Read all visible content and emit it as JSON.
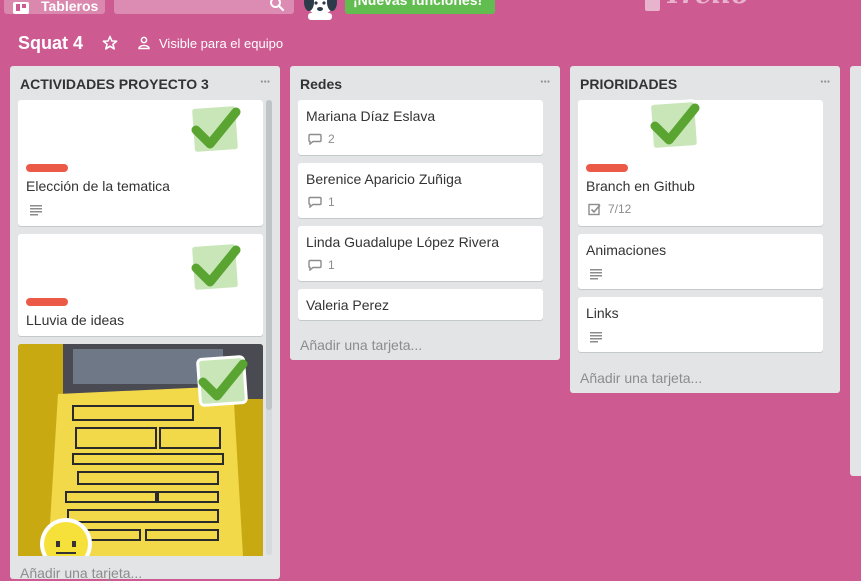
{
  "header": {
    "boards_label": "Tableros",
    "search_value": "",
    "new_features_label": "¡Nuevas funciones!",
    "logo_text": "Trello"
  },
  "board": {
    "title": "Squat 4",
    "visibility": "Visible para el equipo"
  },
  "colors": {
    "background": "#cd5a91",
    "list_bg": "#e2e4e6",
    "label_red": "#eb5a46",
    "check_green": "#61bd4f",
    "new_features_green": "#61bd4f"
  },
  "lists": [
    {
      "title": "ACTIVIDADES PROYECTO 3",
      "cards": [
        {
          "title": "Elección de la tematica",
          "label": "red",
          "badge": "description-icon",
          "sticker": "check"
        },
        {
          "title": "LLuvia de ideas",
          "label": "red",
          "sticker": "check"
        },
        {
          "title": "",
          "cover": "sketch-photo",
          "sticker": "check"
        }
      ],
      "add_card": "Añadir una tarjeta..."
    },
    {
      "title": "Redes",
      "cards": [
        {
          "title": "Mariana Díaz Eslava",
          "comments": "2"
        },
        {
          "title": "Berenice Aparicio Zuñiga",
          "comments": "1"
        },
        {
          "title": "Linda Guadalupe López Rivera",
          "comments": "1"
        },
        {
          "title": "Valeria Perez"
        }
      ],
      "add_card": "Añadir una tarjeta..."
    },
    {
      "title": "PRIORIDADES",
      "cards": [
        {
          "title": "Branch en Github",
          "label": "red",
          "checklist": "7/12",
          "sticker": "check"
        },
        {
          "title": "Animaciones",
          "badge": "description-icon"
        },
        {
          "title": "Links",
          "badge": "description-icon"
        }
      ],
      "add_card": "Añadir una tarjeta..."
    }
  ],
  "list_menu_glyph": "···"
}
